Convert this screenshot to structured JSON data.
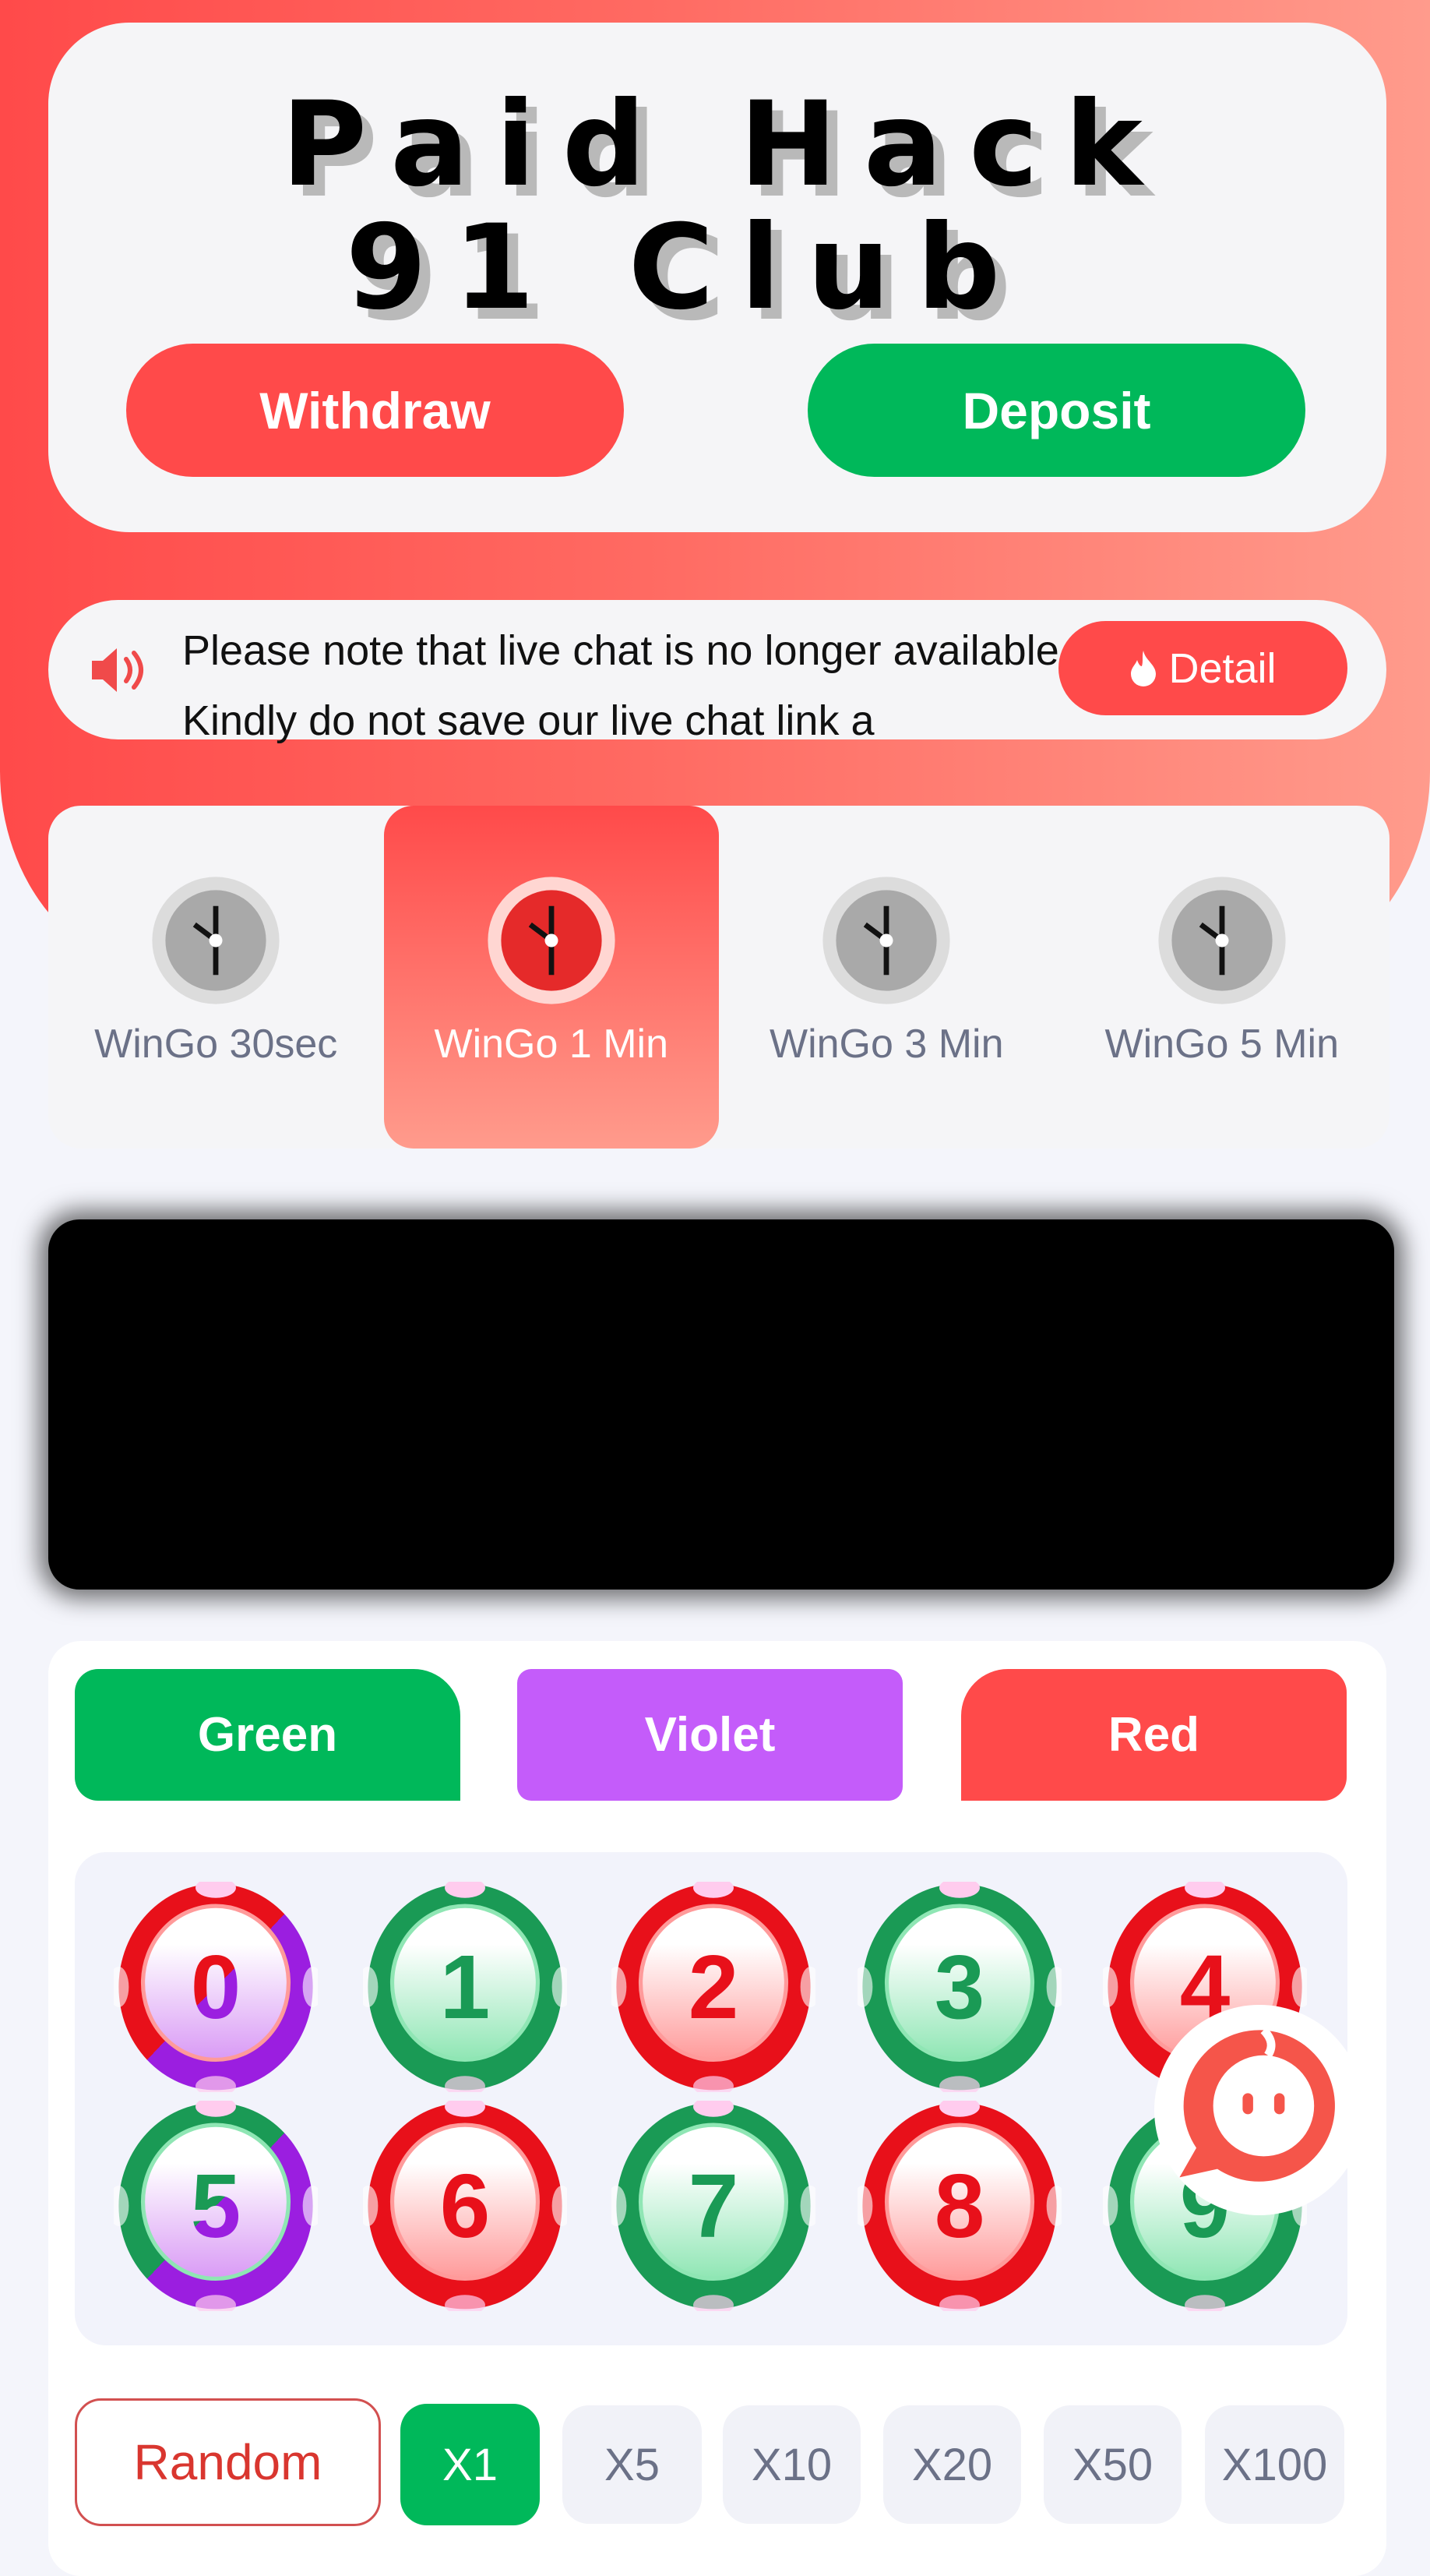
{
  "header": {
    "title_line1": "Paid Hack",
    "title_line2": "91 Club",
    "withdraw_label": "Withdraw",
    "deposit_label": "Deposit"
  },
  "notice": {
    "icon": "speaker-icon",
    "text": "Please note that live chat is no longer available. Kindly do not save our live chat link a",
    "detail_label": "Detail",
    "detail_icon": "flame-icon"
  },
  "game_tabs": [
    {
      "label": "WinGo 30sec",
      "active": false
    },
    {
      "label": "WinGo 1 Min",
      "active": true
    },
    {
      "label": "WinGo 3 Min",
      "active": false
    },
    {
      "label": "WinGo 5 Min",
      "active": false
    }
  ],
  "colors": {
    "green": "#00b85a",
    "violet": "#c45cfa",
    "red": "#ff4a4a"
  },
  "color_buttons": {
    "green": "Green",
    "violet": "Violet",
    "red": "Red"
  },
  "numbers": [
    {
      "n": "0",
      "colors": [
        "red",
        "violet"
      ]
    },
    {
      "n": "1",
      "colors": [
        "green"
      ]
    },
    {
      "n": "2",
      "colors": [
        "red"
      ]
    },
    {
      "n": "3",
      "colors": [
        "green"
      ]
    },
    {
      "n": "4",
      "colors": [
        "red"
      ]
    },
    {
      "n": "5",
      "colors": [
        "green",
        "violet"
      ]
    },
    {
      "n": "6",
      "colors": [
        "red"
      ]
    },
    {
      "n": "7",
      "colors": [
        "green"
      ]
    },
    {
      "n": "8",
      "colors": [
        "red"
      ]
    },
    {
      "n": "9",
      "colors": [
        "green"
      ]
    }
  ],
  "bet": {
    "random_label": "Random",
    "multipliers": [
      "X1",
      "X5",
      "X10",
      "X20",
      "X50",
      "X100"
    ],
    "selected": "X1"
  },
  "chat_icon": "chat-bubble-icon"
}
